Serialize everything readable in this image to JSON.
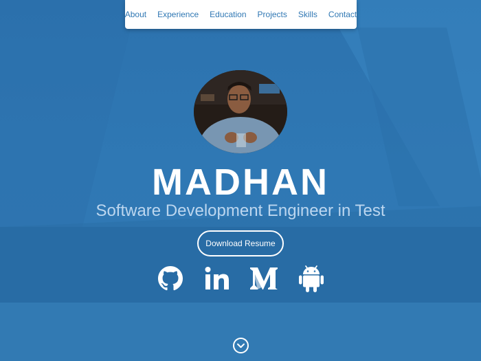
{
  "nav": {
    "items": [
      {
        "label": "About"
      },
      {
        "label": "Experience"
      },
      {
        "label": "Education"
      },
      {
        "label": "Projects"
      },
      {
        "label": "Skills"
      },
      {
        "label": "Contact"
      }
    ]
  },
  "hero": {
    "name": "MADHAN",
    "subtitle": "Software Development Engineer in Test",
    "resume_button": "Download Resume",
    "social_icons": [
      "github-icon",
      "linkedin-icon",
      "medium-icon",
      "android-icon"
    ],
    "scroll_icon": "chevron-down-icon"
  },
  "colors": {
    "background": "#2f77b3",
    "nav_link": "#2f77b3",
    "subtitle": "#bcd6ef",
    "text": "#ffffff"
  }
}
